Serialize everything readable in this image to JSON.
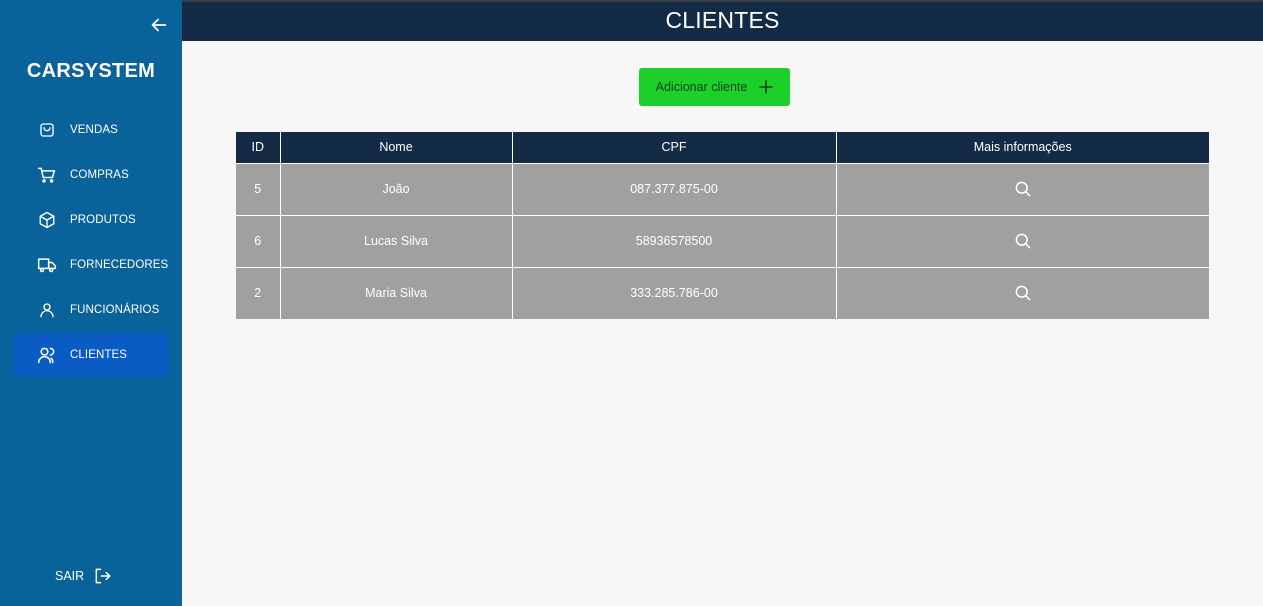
{
  "sidebar": {
    "brand": "CARSYSTEM",
    "items": [
      {
        "label": "VENDAS",
        "icon": "shopping-bag-icon"
      },
      {
        "label": "COMPRAS",
        "icon": "shopping-cart-icon"
      },
      {
        "label": "PRODUTOS",
        "icon": "package-icon"
      },
      {
        "label": "FORNECEDORES",
        "icon": "truck-icon"
      },
      {
        "label": "FUNCIONÁRIOS",
        "icon": "user-icon"
      },
      {
        "label": "CLIENTES",
        "icon": "users-icon",
        "active": true
      }
    ],
    "logout_label": "SAIR"
  },
  "header": {
    "title": "CLIENTES"
  },
  "actions": {
    "add_label": "Adicionar cliente"
  },
  "table": {
    "columns": [
      "ID",
      "Nome",
      "CPF",
      "Mais informações"
    ],
    "rows": [
      {
        "id": "5",
        "nome": "João",
        "cpf": "087.377.875-00"
      },
      {
        "id": "6",
        "nome": "Lucas Silva",
        "cpf": "58936578500"
      },
      {
        "id": "2",
        "nome": "Maria Silva",
        "cpf": "333.285.786-00"
      }
    ]
  },
  "colors": {
    "sidebar": "#0a629b",
    "active_item": "#0b5bc4",
    "header": "#142b45",
    "add_button": "#1cd02a",
    "row": "#a0a0a0",
    "background": "#f7f7f8"
  }
}
